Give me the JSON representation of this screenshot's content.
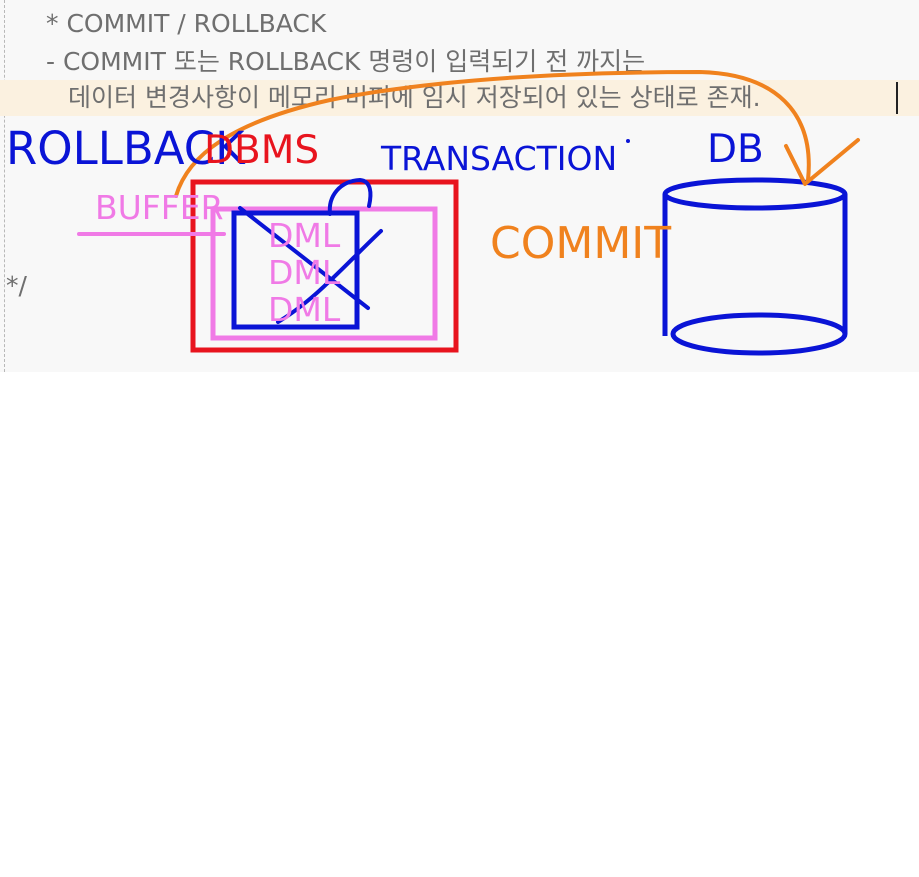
{
  "editor": {
    "lines": [
      "* COMMIT / ROLLBACK",
      "- COMMIT 또는 ROLLBACK 명령이 입력되기 전 까지는",
      "데이터 변경사항이 메모리 버퍼에 임시 저장되어 있는 상태로 존재.",
      "*/"
    ]
  },
  "annotations": {
    "rollback": "ROLLBACK",
    "dbms": "DBMS",
    "transaction": "TRANSACTION",
    "db": "DB",
    "buffer": "BUFFER",
    "commit": "COMMIT",
    "dml": [
      "DML",
      "DML",
      "DML"
    ]
  },
  "colors": {
    "blue": "#0a14d6",
    "red": "#e8141e",
    "orange": "#f0821e",
    "pink": "#f07ae6",
    "code_text": "#6f6f6f",
    "highlight": "#fbf1e0"
  }
}
